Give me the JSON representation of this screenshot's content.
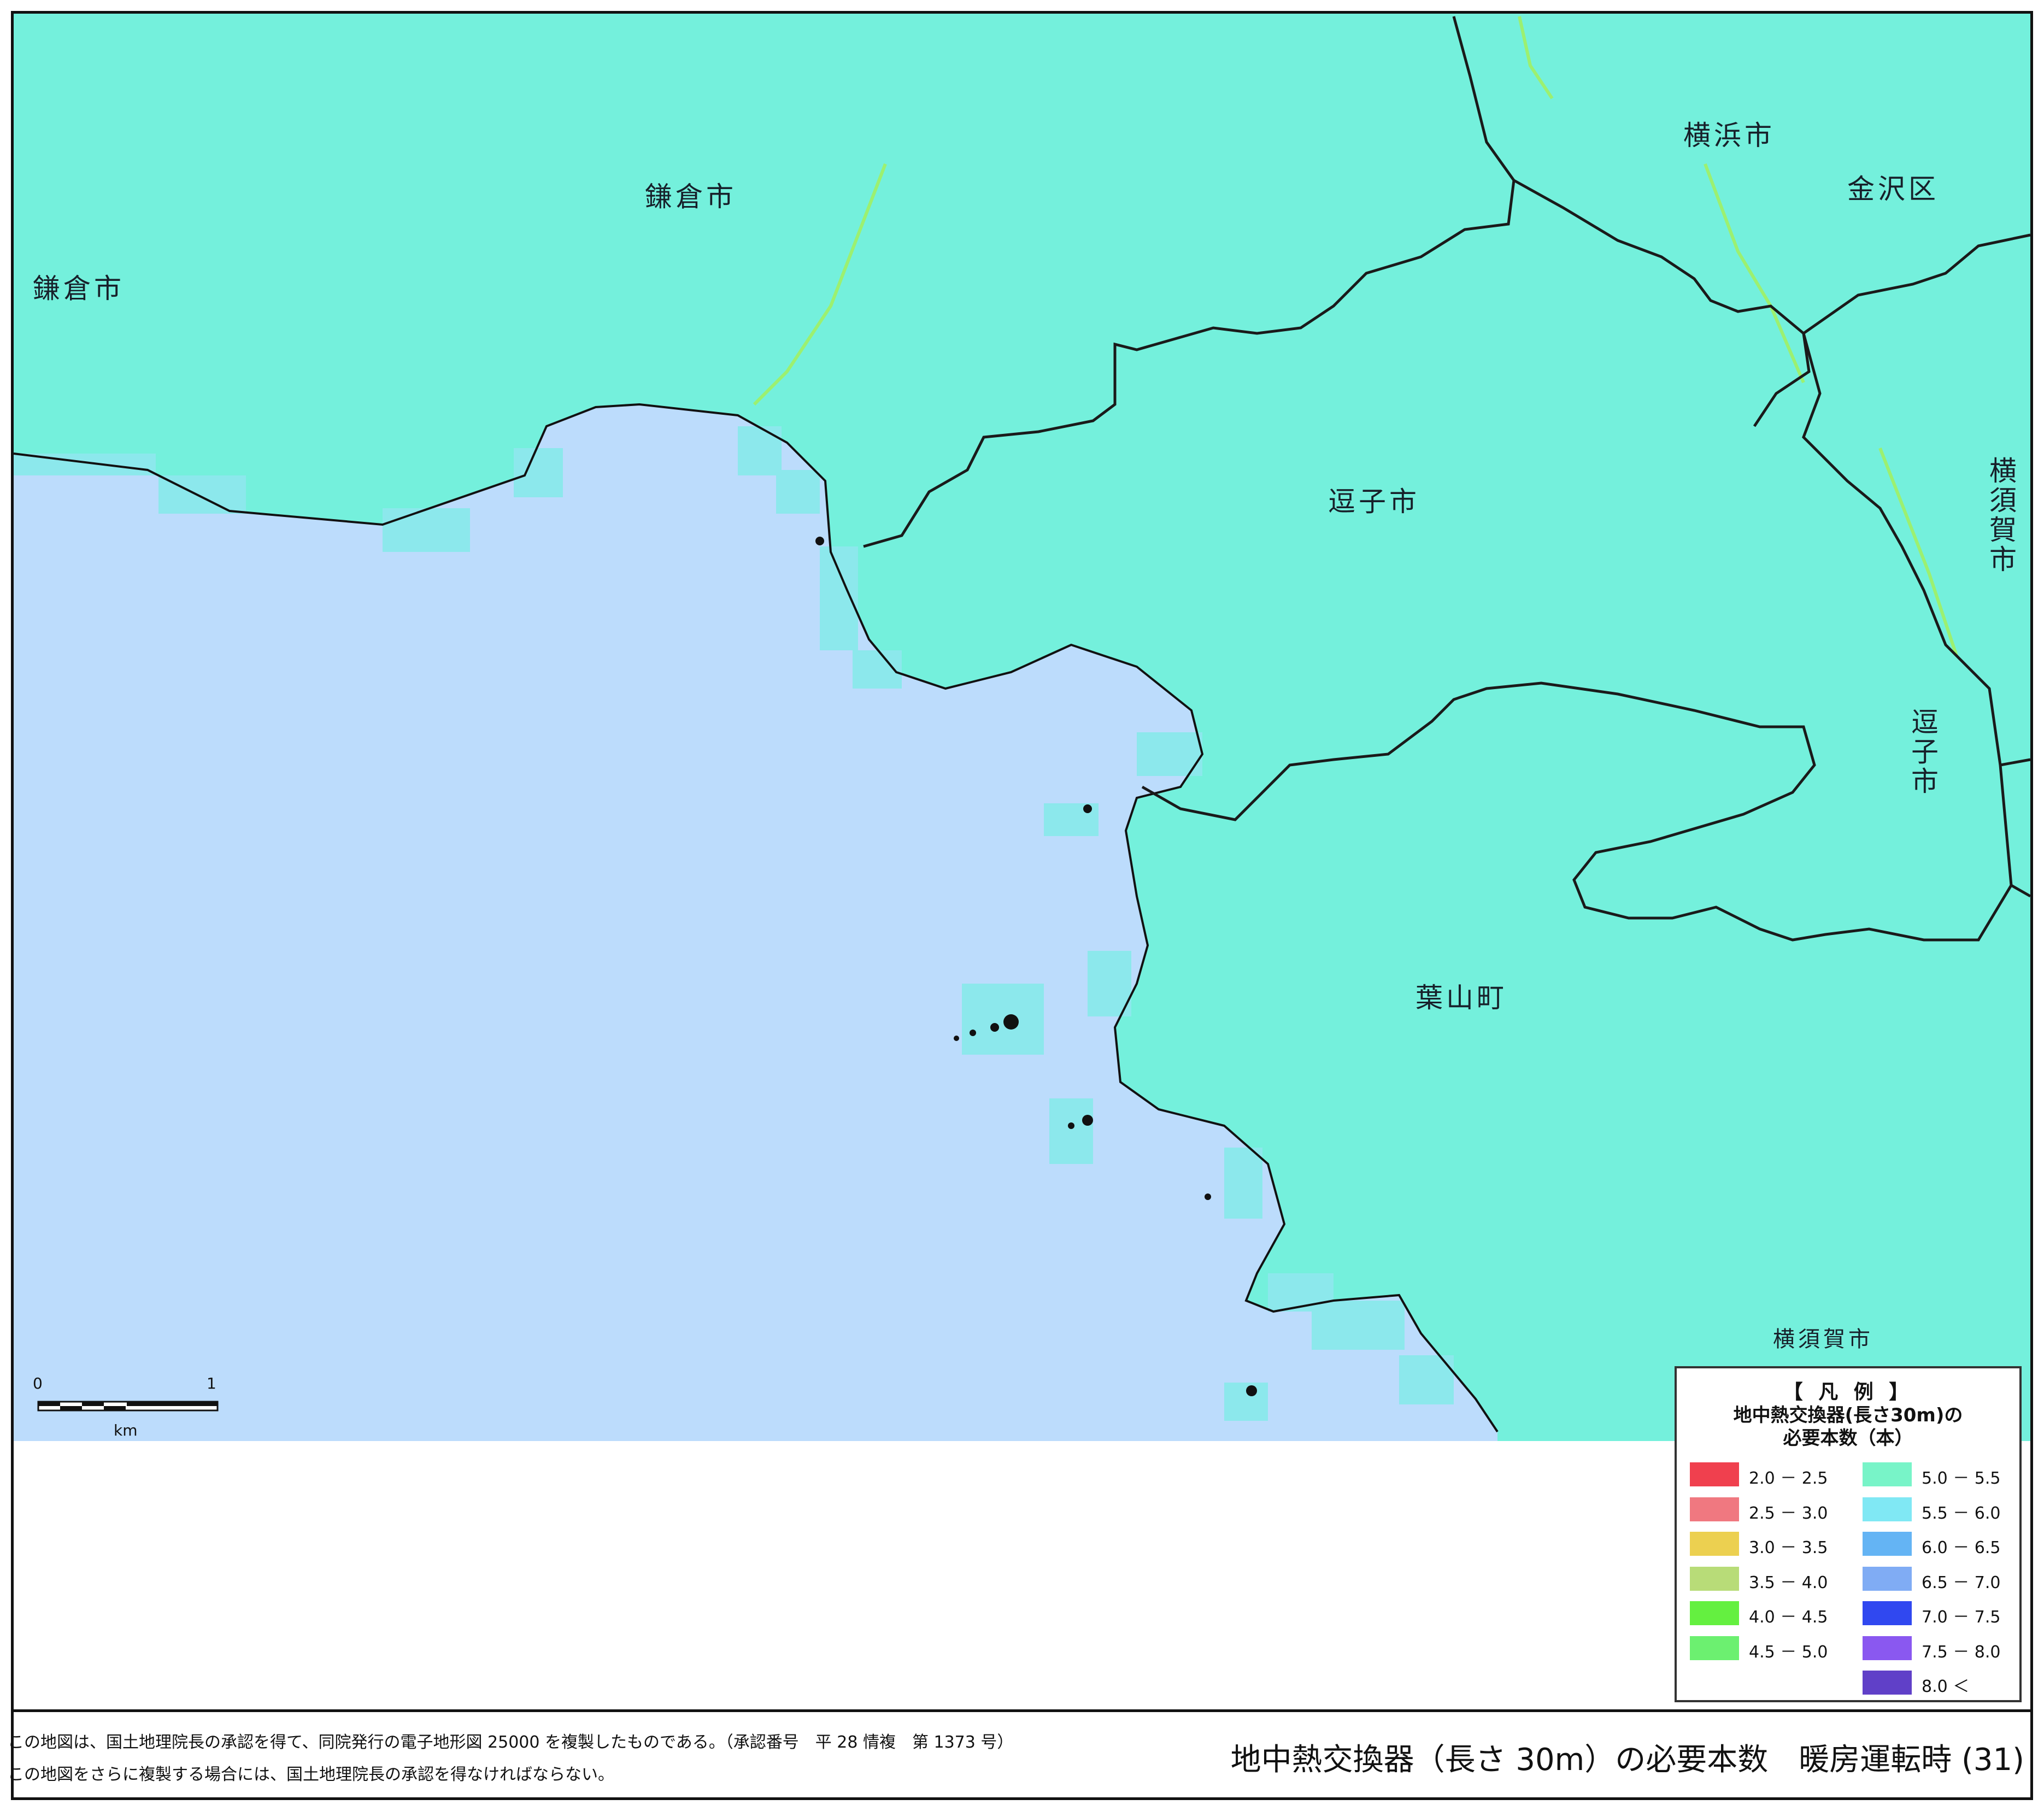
{
  "places": {
    "kamakura_city_1": "鎌倉市",
    "kamakura_city_2": "鎌倉市",
    "yokohama_city": "横浜市",
    "kanazawa_ward": "金沢区",
    "yokosuka_city_1": "横須賀市",
    "zushi_city_1": "逗子市",
    "zushi_city_2": "逗子市",
    "hayama_town": "葉山町",
    "yokosuka_city_2": "横須賀市"
  },
  "scale": {
    "zero": "0",
    "one": "1",
    "unit": "km"
  },
  "legend": {
    "title": "【 凡 例 】",
    "subtitle1": "地中熱交換器(長さ30m)の",
    "subtitle2": "必要本数（本）",
    "items": [
      {
        "label": "2.0 － 2.5",
        "color": "#f0404e"
      },
      {
        "label": "2.5 － 3.0",
        "color": "#f07880"
      },
      {
        "label": "3.0 － 3.5",
        "color": "#ecd050"
      },
      {
        "label": "3.5 － 4.0",
        "color": "#b8dc78"
      },
      {
        "label": "4.0 － 4.5",
        "color": "#64f040"
      },
      {
        "label": "4.5 － 5.0",
        "color": "#6cf070"
      },
      {
        "label": "5.0 － 5.5",
        "color": "#78f4c8"
      },
      {
        "label": "5.5 － 6.0",
        "color": "#80e8f4"
      },
      {
        "label": "6.0 － 6.5",
        "color": "#64b4f4"
      },
      {
        "label": "6.5 － 7.0",
        "color": "#80acf4"
      },
      {
        "label": "7.0 － 7.5",
        "color": "#3048f0"
      },
      {
        "label": "7.5 － 8.0",
        "color": "#8a58f0"
      },
      {
        "label": "8.0 ＜",
        "color": "#6040c8"
      }
    ]
  },
  "footer": {
    "note1": "この地図は、国土地理院長の承認を得て、同院発行の電子地形図 25000 を複製したものである。（承認番号　平 28 情複　第 1373 号）",
    "note2": "この地図をさらに複製する場合には、国土地理院長の承認を得なければならない。",
    "title": "地中熱交換器（長さ 30m）の必要本数　暖房運転時 (31)"
  },
  "colors": {
    "land": "#74f0dc",
    "sea": "#bcdcfc",
    "shore_cell": "#8ce8ec",
    "boundary": "#1a1a1a",
    "road": "#9cf070"
  }
}
